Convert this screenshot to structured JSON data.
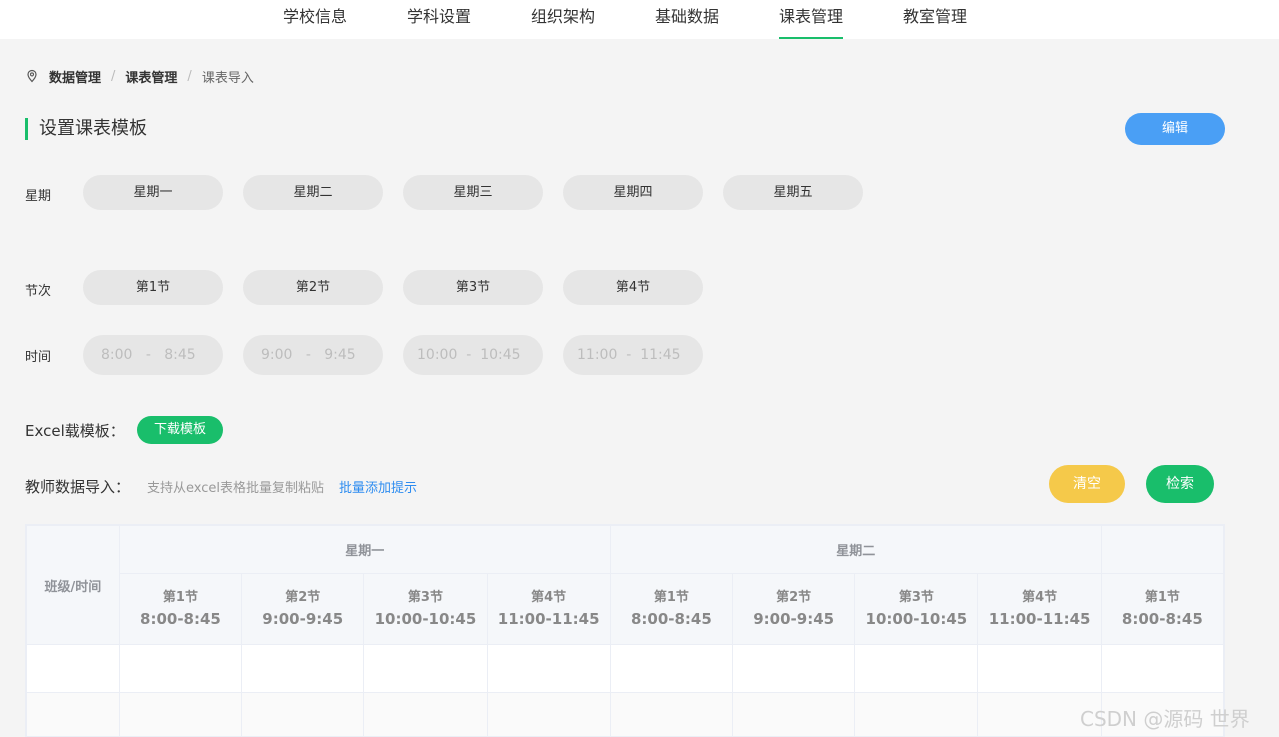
{
  "nav": {
    "items": [
      {
        "label": "学校信息"
      },
      {
        "label": "学科设置"
      },
      {
        "label": "组织架构"
      },
      {
        "label": "基础数据"
      },
      {
        "label": "课表管理",
        "active": true
      },
      {
        "label": "教室管理"
      }
    ]
  },
  "breadcrumb": {
    "level1": "数据管理",
    "sep": "/",
    "level2": "课表管理",
    "current": "课表导入"
  },
  "section": {
    "title": "设置课表模板",
    "edit_label": "编辑"
  },
  "week_row": {
    "label": "星期",
    "days": [
      "星期一",
      "星期二",
      "星期三",
      "星期四",
      "星期五"
    ]
  },
  "period_row": {
    "label": "节次",
    "periods": [
      "第1节",
      "第2节",
      "第3节",
      "第4节"
    ]
  },
  "time_row": {
    "label": "时间",
    "times": [
      {
        "start": "8:00",
        "sep": "-",
        "end": "8:45"
      },
      {
        "start": "9:00",
        "sep": "-",
        "end": "9:45"
      },
      {
        "start": "10:00",
        "sep": "-",
        "end": "10:45"
      },
      {
        "start": "11:00",
        "sep": "-",
        "end": "11:45"
      }
    ]
  },
  "excel": {
    "label": "Excel载模板：",
    "download_label": "下载模板"
  },
  "import": {
    "label": "教师数据导入：",
    "hint": "支持从excel表格批量复制粘贴",
    "link": "批量添加提示",
    "clear_label": "清空",
    "search_label": "检索"
  },
  "table": {
    "corner": "班级/时间",
    "days": [
      "星期一",
      "星期二",
      ""
    ],
    "periods": [
      {
        "name": "第1节",
        "time": "8:00-8:45"
      },
      {
        "name": "第2节",
        "time": "9:00-9:45"
      },
      {
        "name": "第3节",
        "time": "10:00-10:45"
      },
      {
        "name": "第4节",
        "time": "11:00-11:45"
      },
      {
        "name": "第1节",
        "time": "8:00-8:45"
      },
      {
        "name": "第2节",
        "time": "9:00-9:45"
      },
      {
        "name": "第3节",
        "time": "10:00-10:45"
      },
      {
        "name": "第4节",
        "time": "11:00-11:45"
      },
      {
        "name": "第1节",
        "time": "8:00-8:45"
      }
    ]
  },
  "watermark": "CSDN @源码 世界",
  "colors": {
    "accent_green": "#19be6b",
    "edit_blue": "#4a9ff5",
    "clear_yellow": "#f5c94a",
    "link_blue": "#2d8cf0"
  }
}
